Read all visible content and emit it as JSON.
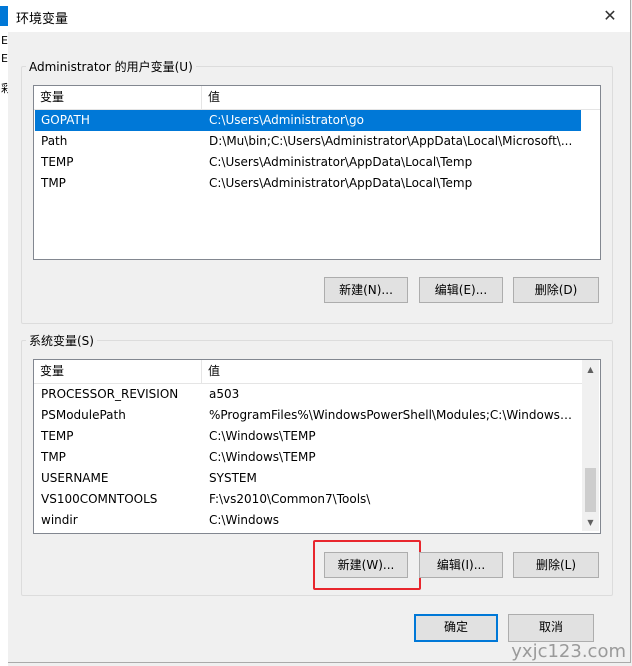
{
  "window": {
    "title": "环境变量",
    "close_glyph": "✕"
  },
  "background_fragments": [
    "E",
    "E",
    "彩"
  ],
  "user_section": {
    "label": "Administrator 的用户变量(U)",
    "columns": [
      "变量",
      "值"
    ],
    "rows": [
      {
        "name": "GOPATH",
        "value": "C:\\Users\\Administrator\\go",
        "selected": true
      },
      {
        "name": "Path",
        "value": "D:\\Mu\\bin;C:\\Users\\Administrator\\AppData\\Local\\Microsoft\\...",
        "selected": false
      },
      {
        "name": "TEMP",
        "value": "C:\\Users\\Administrator\\AppData\\Local\\Temp",
        "selected": false
      },
      {
        "name": "TMP",
        "value": "C:\\Users\\Administrator\\AppData\\Local\\Temp",
        "selected": false
      }
    ],
    "buttons": {
      "new": "新建(N)...",
      "edit": "编辑(E)...",
      "delete": "删除(D)"
    }
  },
  "system_section": {
    "label": "系统变量(S)",
    "columns": [
      "变量",
      "值"
    ],
    "rows": [
      {
        "name": "PROCESSOR_REVISION",
        "value": "a503"
      },
      {
        "name": "PSModulePath",
        "value": "%ProgramFiles%\\WindowsPowerShell\\Modules;C:\\Windows\\..."
      },
      {
        "name": "TEMP",
        "value": "C:\\Windows\\TEMP"
      },
      {
        "name": "TMP",
        "value": "C:\\Windows\\TEMP"
      },
      {
        "name": "USERNAME",
        "value": "SYSTEM"
      },
      {
        "name": "VS100COMNTOOLS",
        "value": "F:\\vs2010\\Common7\\Tools\\"
      },
      {
        "name": "windir",
        "value": "C:\\Windows"
      }
    ],
    "buttons": {
      "new": "新建(W)...",
      "edit": "编辑(I)...",
      "delete": "删除(L)"
    }
  },
  "footer": {
    "ok": "确定",
    "cancel": "取消"
  },
  "watermark": "yxjc123.com",
  "colors": {
    "selection": "#0078d7",
    "highlight": "#e8262d",
    "primary_border": "#0078d7"
  },
  "icons": {
    "scroll_up": "triangle-up",
    "scroll_down": "triangle-down"
  }
}
